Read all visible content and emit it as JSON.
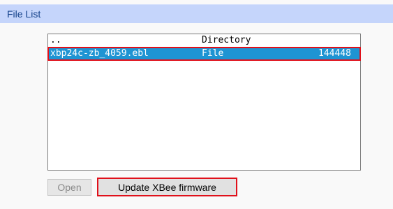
{
  "panel": {
    "title": "File List"
  },
  "file_list": {
    "rows": [
      {
        "name": "..",
        "type": "Directory",
        "size": ""
      },
      {
        "name": "xbp24c-zb_4059.ebl",
        "type": "File",
        "size": "144448"
      }
    ],
    "selected_row": 1
  },
  "buttons": {
    "open_label": "Open",
    "update_label": "Update XBee firmware"
  },
  "colors": {
    "header_bg": "#c5d5fb",
    "selection_bg": "#1e94d3",
    "highlight_border": "#e0101a"
  }
}
